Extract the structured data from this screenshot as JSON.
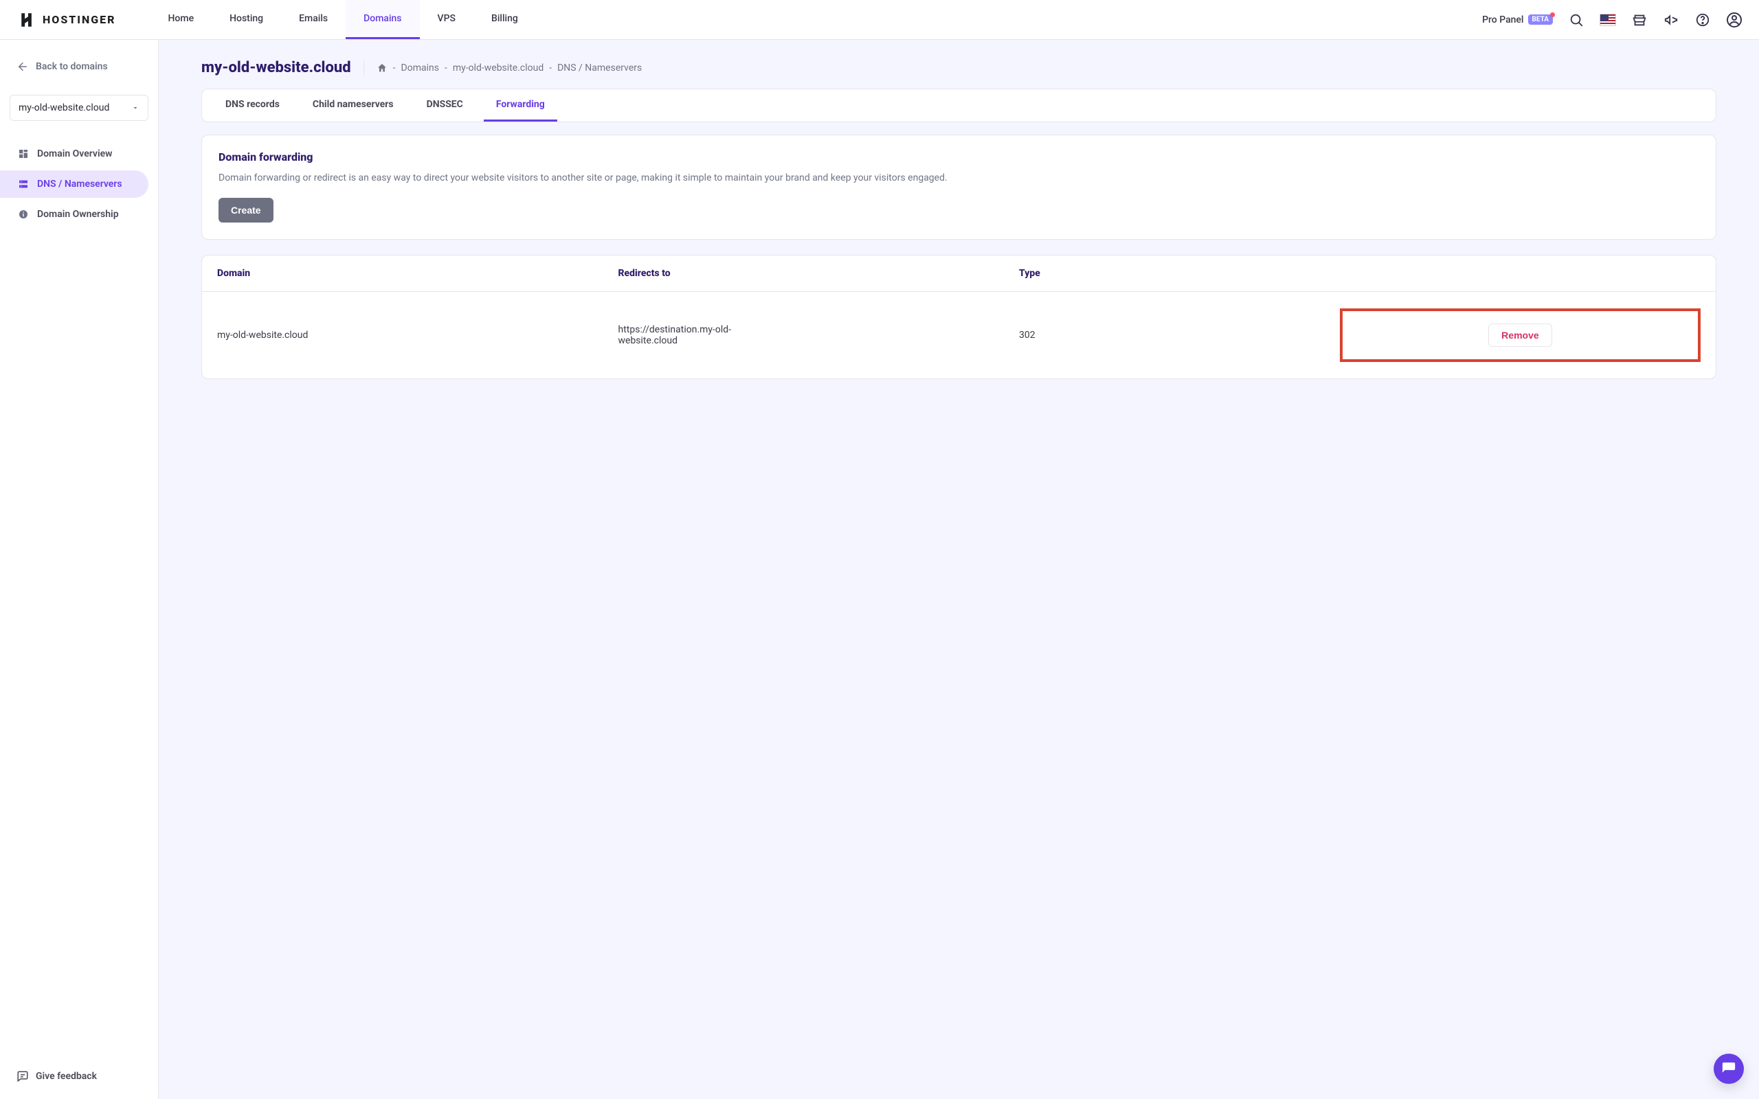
{
  "brand": {
    "name": "HOSTINGER"
  },
  "nav": {
    "items": [
      {
        "label": "Home"
      },
      {
        "label": "Hosting"
      },
      {
        "label": "Emails"
      },
      {
        "label": "Domains",
        "active": true
      },
      {
        "label": "VPS"
      },
      {
        "label": "Billing"
      }
    ],
    "pro_panel_label": "Pro Panel",
    "beta_label": "BETA"
  },
  "sidebar": {
    "back_label": "Back to domains",
    "domain_select_value": "my-old-website.cloud",
    "items": [
      {
        "label": "Domain Overview"
      },
      {
        "label": "DNS / Nameservers",
        "active": true
      },
      {
        "label": "Domain Ownership"
      }
    ],
    "feedback_label": "Give feedback"
  },
  "page": {
    "title": "my-old-website.cloud",
    "breadcrumb": [
      "Domains",
      "my-old-website.cloud",
      "DNS / Nameservers"
    ]
  },
  "tabs": [
    {
      "label": "DNS records"
    },
    {
      "label": "Child nameservers"
    },
    {
      "label": "DNSSEC"
    },
    {
      "label": "Forwarding",
      "active": true
    }
  ],
  "forwarding_panel": {
    "title": "Domain forwarding",
    "description": "Domain forwarding or redirect is an easy way to direct your website visitors to another site or page, making it simple to maintain your brand and keep your visitors engaged.",
    "create_label": "Create"
  },
  "forwarding_table": {
    "headers": {
      "domain": "Domain",
      "redirects_to": "Redirects to",
      "type": "Type"
    },
    "rows": [
      {
        "domain": "my-old-website.cloud",
        "redirects_to": "https://destination.my-old-website.cloud",
        "type": "302",
        "remove_label": "Remove"
      }
    ]
  }
}
